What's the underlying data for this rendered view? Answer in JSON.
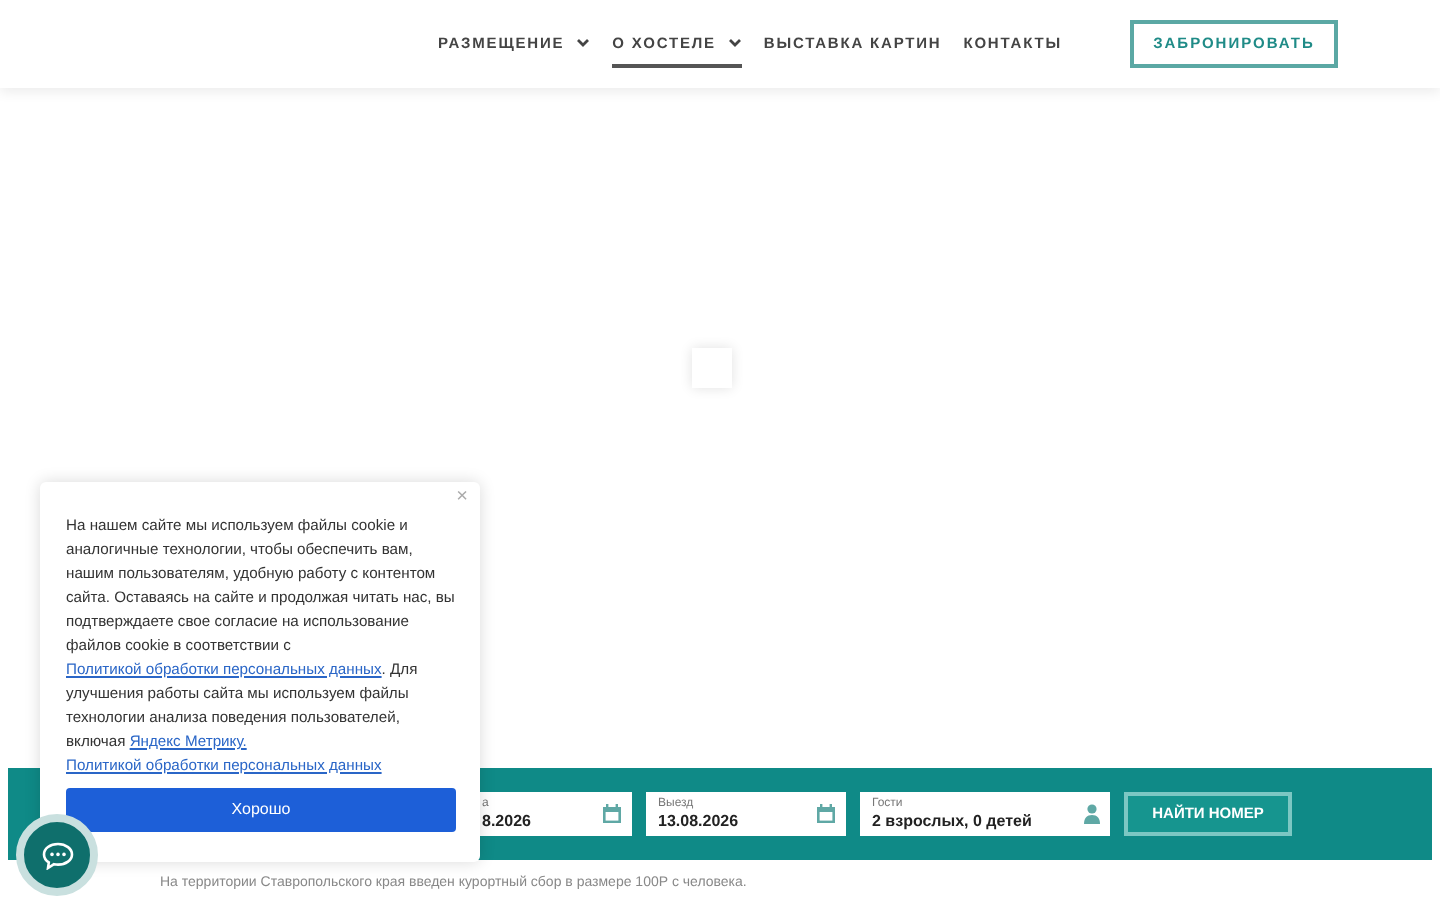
{
  "nav": {
    "items": [
      {
        "label": "РАЗМЕЩЕНИЕ",
        "dropdown": true,
        "selected": false
      },
      {
        "label": "О ХОСТЕЛЕ",
        "dropdown": true,
        "selected": true
      },
      {
        "label": "ВЫСТАВКА КАРТИН",
        "dropdown": false,
        "selected": false
      },
      {
        "label": "КОНТАКТЫ",
        "dropdown": false,
        "selected": false
      }
    ],
    "book_button": "ЗАБРОНИРОВАТЬ"
  },
  "booking_bar": {
    "fields": [
      {
        "kind": "date",
        "label": "а",
        "value": "8.2026"
      },
      {
        "kind": "date",
        "label": "Выезд",
        "value": "13.08.2026"
      },
      {
        "kind": "guests",
        "label": "Гости",
        "value": "2 взрослых, 0 детей"
      }
    ],
    "search_button": "НАЙТИ НОМЕР"
  },
  "notice": "На территории Ставропольского края введен курортный сбор в размере 100Р с человека.",
  "cookie_popup": {
    "close": "×",
    "parts": [
      {
        "kind": "text",
        "text": "На нашем сайте мы используем файлы cookie и аналогичные технологии, чтобы обеспечить вам, нашим пользователям, удобную работу с контентом сайта. Оставаясь на сайте и продолжая читать нас, вы подтверждаете свое согласие на использование файлов cookie в соответствии с "
      },
      {
        "kind": "link",
        "text": "Политикой обработки персональных данных"
      },
      {
        "kind": "text",
        "text": ". Для улучшения работы сайта  мы используем файлы технологии анализа поведения пользователей, включая "
      },
      {
        "kind": "link",
        "text": "Яндекс Метрику."
      }
    ],
    "link": "Политикой обработки персональных данных",
    "ok_button": "Хорошо"
  }
}
